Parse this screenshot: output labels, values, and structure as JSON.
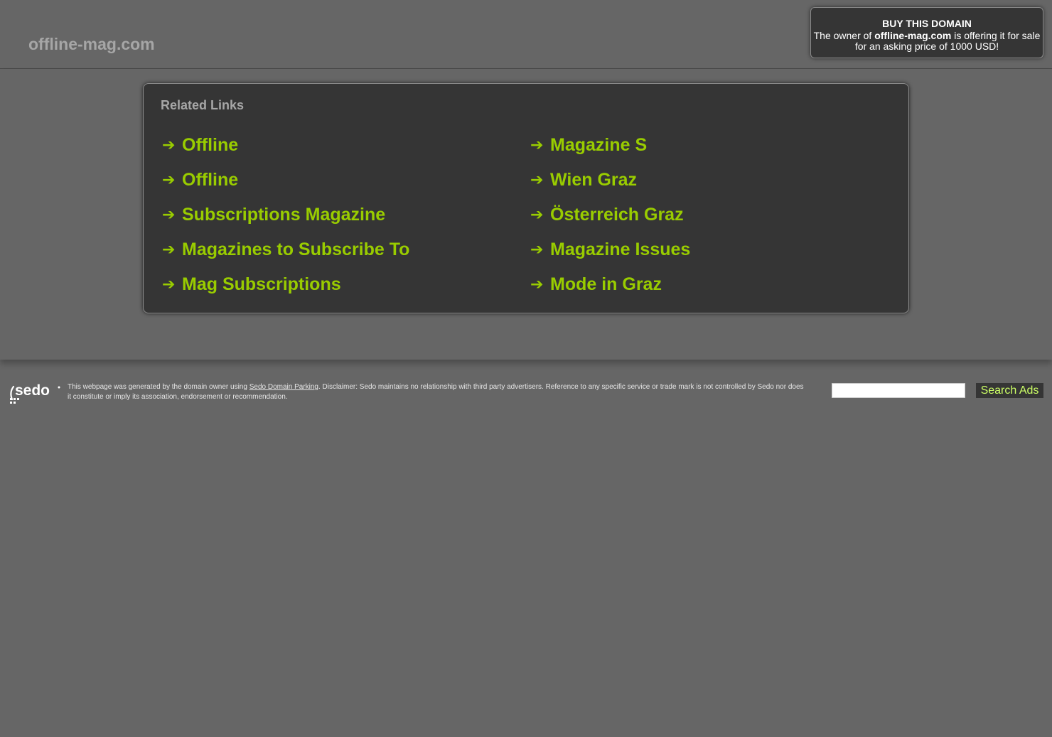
{
  "header": {
    "site_title": "offline-mag.com"
  },
  "buy_box": {
    "title": "BUY THIS DOMAIN",
    "text_prefix": "The owner of ",
    "domain": "offline-mag.com",
    "text_suffix": " is offering it for sale for an asking price of 1000 USD!"
  },
  "related_links": {
    "title": "Related Links",
    "arrow": "➔",
    "left": [
      {
        "label": "Offline"
      },
      {
        "label": "Offline"
      },
      {
        "label": "Subscriptions Magazine"
      },
      {
        "label": "Magazines to Subscribe To"
      },
      {
        "label": "Mag Subscriptions"
      }
    ],
    "right": [
      {
        "label": "Magazine S"
      },
      {
        "label": "Wien Graz"
      },
      {
        "label": "Österreich Graz"
      },
      {
        "label": "Magazine Issues"
      },
      {
        "label": "Mode in Graz"
      }
    ]
  },
  "footer": {
    "logo_text": "sedo",
    "disclaimer_prefix": "This webpage was generated by the domain owner using ",
    "disclaimer_link": "Sedo Domain Parking",
    "disclaimer_suffix": ". Disclaimer: Sedo maintains no relationship with third party advertisers. Reference to any specific service or trade mark is not controlled by Sedo nor does it constitute or imply its association, endorsement or recommendation.",
    "search_input_value": "",
    "search_button_label": "Search Ads"
  },
  "colors": {
    "background": "#666666",
    "panel": "#353535",
    "link_green": "#99cc00",
    "button_text": "#ccff66"
  }
}
